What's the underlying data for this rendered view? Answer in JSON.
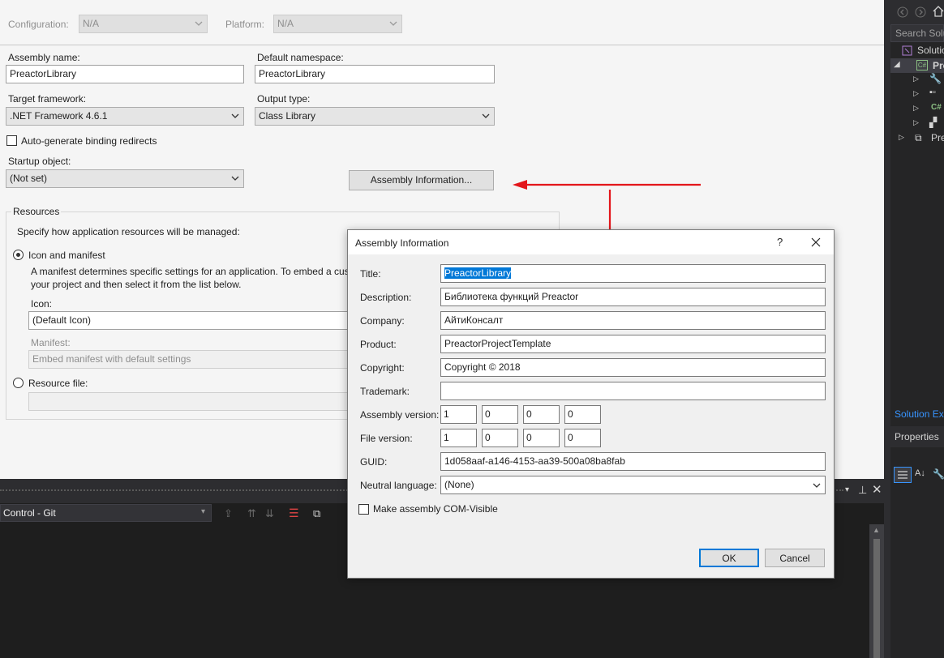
{
  "properties": {
    "configuration_label": "Configuration:",
    "configuration_value": "N/A",
    "platform_label": "Platform:",
    "platform_value": "N/A",
    "assembly_name_label": "Assembly name:",
    "assembly_name_value": "PreactorLibrary",
    "default_namespace_label": "Default namespace:",
    "default_namespace_value": "PreactorLibrary",
    "target_framework_label": "Target framework:",
    "target_framework_value": ".NET Framework 4.6.1",
    "output_type_label": "Output type:",
    "output_type_value": "Class Library",
    "auto_binding_label": "Auto-generate binding redirects",
    "startup_object_label": "Startup object:",
    "startup_object_value": "(Not set)",
    "assembly_info_button": "Assembly Information...",
    "resources_group_label": "Resources",
    "resources_desc": "Specify how application resources will be managed:",
    "icon_manifest_label": "Icon and manifest",
    "manifest_desc_line1": "A manifest determines specific settings for an application. To embed a cus",
    "manifest_desc_line2": "your project and then select it from the list below.",
    "icon_label": "Icon:",
    "icon_value": "(Default Icon)",
    "manifest_label": "Manifest:",
    "manifest_value": "Embed manifest with default settings",
    "resource_file_label": "Resource file:"
  },
  "git_pane": {
    "title": "Control - Git"
  },
  "right_panel": {
    "search_placeholder": "Search Solu",
    "solution_label": "Solutio",
    "project_label": "Pre",
    "project2_label": "Pre",
    "solution_explorer_tab": "Solution Ex",
    "properties_title": "Properties"
  },
  "dialog": {
    "title": "Assembly Information",
    "help": "?",
    "fields": {
      "title_label": "Title:",
      "title_value": "PreactorLibrary",
      "description_label": "Description:",
      "description_value": "Библиотека функций Preactor",
      "company_label": "Company:",
      "company_value": "АйтиКонсалт",
      "product_label": "Product:",
      "product_value": "PreactorProjectTemplate",
      "copyright_label": "Copyright:",
      "copyright_value": "Copyright ©  2018",
      "trademark_label": "Trademark:",
      "trademark_value": "",
      "assembly_version_label": "Assembly version:",
      "assembly_version": [
        "1",
        "0",
        "0",
        "0"
      ],
      "file_version_label": "File version:",
      "file_version": [
        "1",
        "0",
        "0",
        "0"
      ],
      "guid_label": "GUID:",
      "guid_value": "1d058aaf-a146-4153-aa39-500a08ba8fab",
      "neutral_language_label": "Neutral language:",
      "neutral_language_value": "(None)",
      "com_visible_label": "Make assembly COM-Visible"
    },
    "ok_button": "OK",
    "cancel_button": "Cancel"
  },
  "colors": {
    "annotation_arrow": "#e3161b",
    "selection": "#0078d7",
    "vs_dark": "#2d2d30"
  }
}
